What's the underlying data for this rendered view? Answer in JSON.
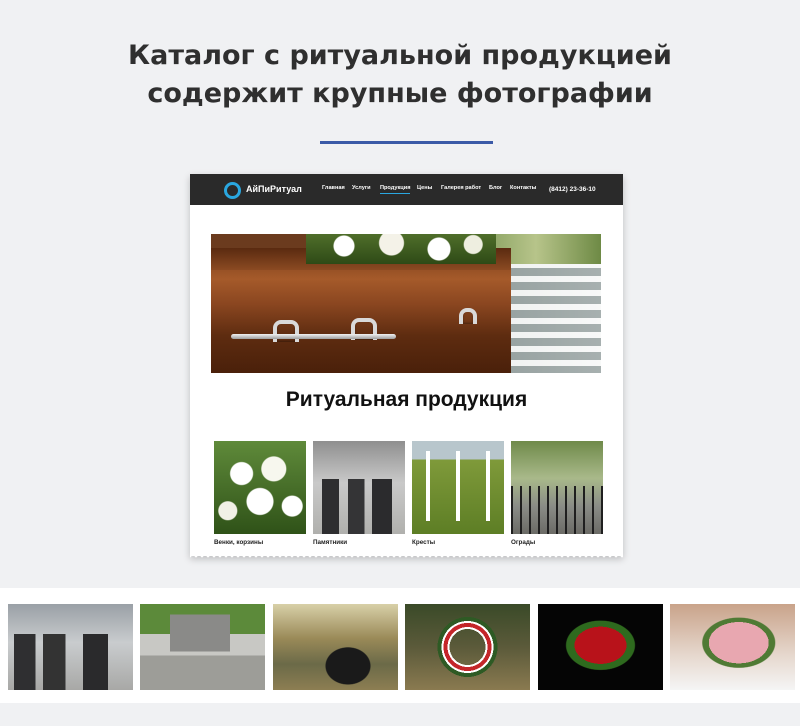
{
  "headline": {
    "line1": "Каталог с ритуальной продукцией",
    "line2": "содержит крупные фотографии"
  },
  "colors": {
    "accent": "#3b5aa7",
    "nav_bg": "#2a2a2a",
    "logo": "#2aa7e0"
  },
  "mock_site": {
    "logo_text": "АйПиРитуал",
    "nav": [
      {
        "label": "Главная",
        "active": false
      },
      {
        "label": "Услуги",
        "active": false
      },
      {
        "label": "Продукция",
        "active": true
      },
      {
        "label": "Цены",
        "active": false
      },
      {
        "label": "Галерея работ",
        "active": false
      },
      {
        "label": "Блог",
        "active": false
      },
      {
        "label": "Контакты",
        "active": false
      }
    ],
    "phone": "(8412) 23-36-10",
    "heading": "Ритуальная продукция",
    "categories": [
      {
        "label": "Венки, корзины",
        "image": "lilies-photo"
      },
      {
        "label": "Памятники",
        "image": "monuments-photo"
      },
      {
        "label": "Кресты",
        "image": "crosses-photo"
      },
      {
        "label": "Ограды",
        "image": "fences-photo"
      }
    ]
  },
  "gallery_strip": [
    {
      "image": "cemetery-monuments-photo"
    },
    {
      "image": "grave-headstone-photo"
    },
    {
      "image": "black-headstone-photo"
    },
    {
      "image": "funeral-wreath-photo"
    },
    {
      "image": "red-roses-wreath-photo"
    },
    {
      "image": "pink-flowers-photo"
    }
  ]
}
